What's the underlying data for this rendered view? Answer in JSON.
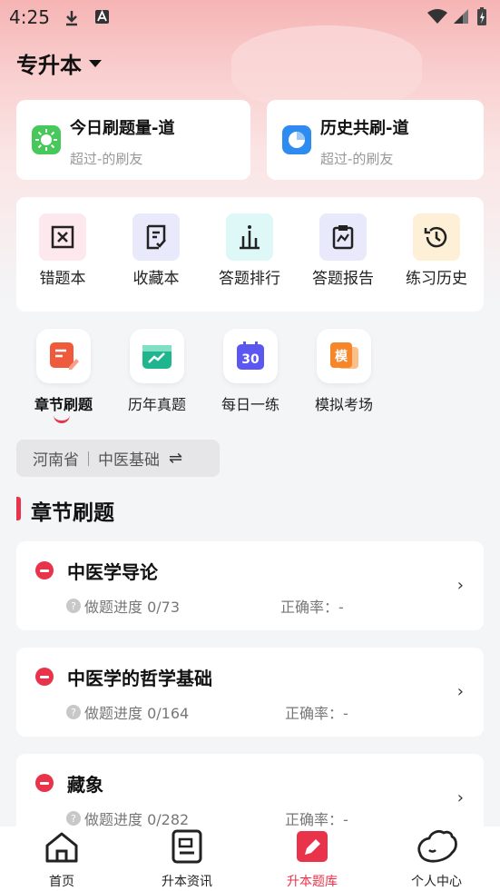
{
  "status_bar": {
    "time": "4:25"
  },
  "header": {
    "title": "专升本"
  },
  "stats": [
    {
      "title": "今日刷题量-道",
      "sub": "超过-的刷友"
    },
    {
      "title": "历史共刷-道",
      "sub": "超过-的刷友"
    }
  ],
  "tools": [
    {
      "label": "错题本",
      "icon": "wrong-book-icon"
    },
    {
      "label": "收藏本",
      "icon": "favorites-icon"
    },
    {
      "label": "答题排行",
      "icon": "ranking-icon"
    },
    {
      "label": "答题报告",
      "icon": "report-icon"
    },
    {
      "label": "练习历史",
      "icon": "history-icon"
    }
  ],
  "tabs": [
    {
      "label": "章节刷题",
      "icon": "chapter-icon",
      "active": true
    },
    {
      "label": "历年真题",
      "icon": "past-papers-icon"
    },
    {
      "label": "每日一练",
      "icon": "daily-icon",
      "badge": "30"
    },
    {
      "label": "模拟考场",
      "icon": "mock-exam-icon",
      "badge": "模"
    }
  ],
  "filter": {
    "province": "河南省",
    "subject": "中医基础",
    "swap_icon": "⇌"
  },
  "section": {
    "title": "章节刷题"
  },
  "chapters": [
    {
      "title": "中医学导论",
      "progress": "做题进度 0/73",
      "accuracy": "正确率：-"
    },
    {
      "title": "中医学的哲学基础",
      "progress": "做题进度 0/164",
      "accuracy": "正确率：-"
    },
    {
      "title": "藏象",
      "progress": "做题进度 0/282",
      "accuracy": "正确率：-"
    }
  ],
  "bottom_nav": [
    {
      "label": "首页",
      "icon": "home-icon"
    },
    {
      "label": "升本资讯",
      "icon": "news-icon"
    },
    {
      "label": "升本题库",
      "icon": "question-bank-icon",
      "active": true
    },
    {
      "label": "个人中心",
      "icon": "profile-icon"
    }
  ],
  "colors": {
    "accent": "#e8334a",
    "background": "#f4f5f7"
  }
}
